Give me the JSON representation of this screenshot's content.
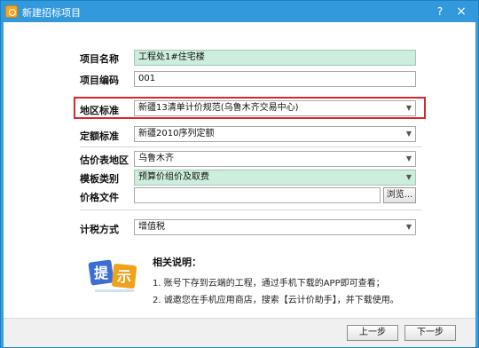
{
  "window": {
    "title": "新建招标项目",
    "help_label": "?",
    "close_label": "×"
  },
  "form": {
    "colon": "：",
    "project_name": {
      "label": "项目名称",
      "value": "工程处1#住宅楼"
    },
    "project_code": {
      "label": "项目编码",
      "value": "001"
    },
    "region_standard": {
      "label": "地区标准",
      "value": "新疆13清单计价规范(乌鲁木齐交易中心)"
    },
    "quota_standard": {
      "label": "定额标准",
      "value": "新疆2010序列定额"
    },
    "price_region": {
      "label": "估价表地区",
      "value": "乌鲁木齐"
    },
    "template_type": {
      "label": "模板类别",
      "value": "预算价组价及取费"
    },
    "price_file": {
      "label": "价格文件",
      "value": "",
      "browse_label": "浏览..."
    },
    "tax_method": {
      "label": "计税方式",
      "value": "增值税"
    },
    "dropdown_arrow": "▼"
  },
  "tips": {
    "icon_text": [
      "提",
      "示"
    ],
    "title": "相关说明：",
    "items": [
      "1. 账号下存到云端的工程，通过手机下载的APP即可查看；",
      "2. 诚邀您在手机应用商店，搜索【云计价助手】，并下载使用。"
    ]
  },
  "footer": {
    "prev_label": "上一步",
    "next_label": "下一步"
  }
}
